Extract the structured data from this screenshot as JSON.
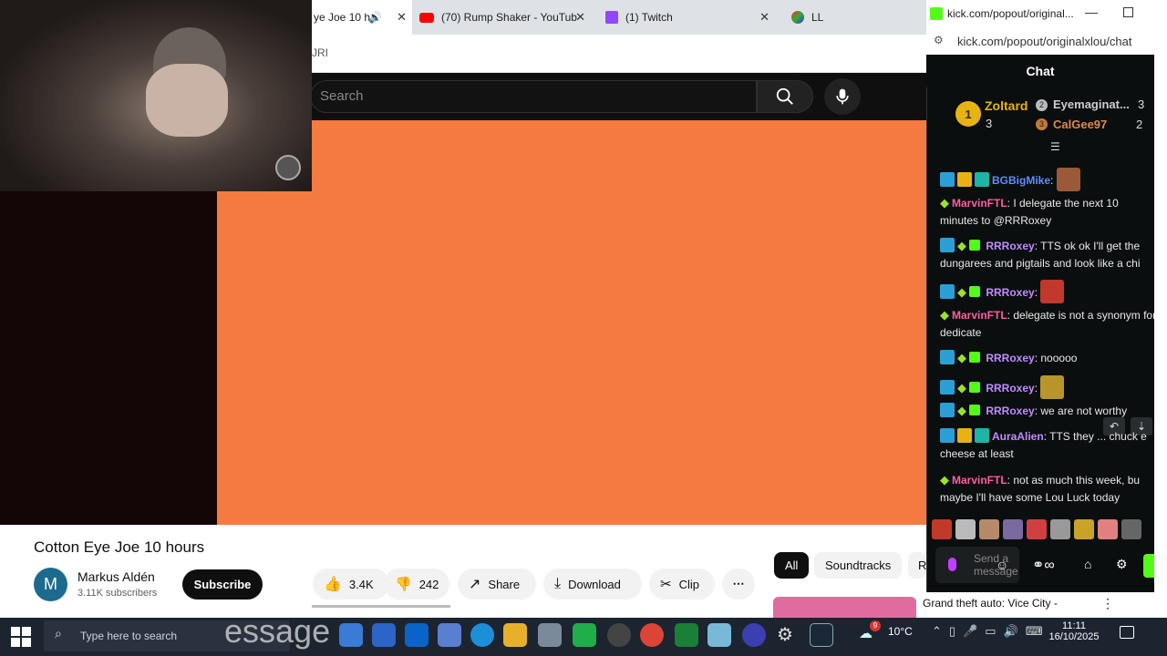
{
  "browser": {
    "tabs": [
      {
        "label": "ye Joe 10 h",
        "icon": "speaker-icon"
      },
      {
        "label": "(70) Rump Shaker - YouTub",
        "icon": "youtube-icon"
      },
      {
        "label": "(1) Twitch",
        "icon": "twitch-icon"
      },
      {
        "label": "LL",
        "icon": "tab-favicon"
      }
    ],
    "address_fragment": "JRI"
  },
  "youtube": {
    "search_placeholder": "Search",
    "video_title": "Cotton Eye Joe 10 hours",
    "channel": {
      "avatar_letter": "M",
      "name": "Markus Aldén",
      "subscribers": "3.11K subscribers"
    },
    "subscribe_label": "Subscribe",
    "likes": "3.4K",
    "dislikes": "242",
    "share_label": "Share",
    "download_label": "Download",
    "clip_label": "Clip",
    "chips": [
      "All",
      "Soundtracks",
      "R"
    ],
    "next_video_title": "Grand theft auto: Vice City -"
  },
  "popout": {
    "window_title": "kick.com/popout/original...",
    "url": "kick.com/popout/originalxlou/chat",
    "chat_header": "Chat",
    "leaderboard": [
      {
        "rank": "1",
        "name": "Zoltard",
        "count": "3"
      },
      {
        "rank": "2",
        "name": "Eyemaginat...",
        "count": "3"
      },
      {
        "rank": "3",
        "name": "CalGee97",
        "count": "2"
      }
    ],
    "messages": [
      {
        "user": "BGBigMike",
        "text": ""
      },
      {
        "user": "MarvinFTL",
        "text": ": I delegate the next 10 minutes to @RRRoxey"
      },
      {
        "user": "RRRoxey",
        "text": ": TTS ok ok I'll get the dungarees and pigtails and look like a chi"
      },
      {
        "user": "RRRoxey",
        "text": ":"
      },
      {
        "user": "MarvinFTL",
        "text": ": delegate is not a synonym for dedicate"
      },
      {
        "user": "RRRoxey",
        "text": ": nooooo"
      },
      {
        "user": "RRRoxey",
        "text": ":"
      },
      {
        "user": "RRRoxey",
        "text": ": we are not worthy"
      },
      {
        "user": "AuraAlien",
        "text": ": TTS they ... chuck e cheese at least"
      },
      {
        "user": "MarvinFTL",
        "text": ": not as much this week, bu maybe I'll have some Lou Luck today"
      }
    ],
    "input_placeholder": "Send a message"
  },
  "taskbar": {
    "search_placeholder": "Type here to search",
    "overlay_text": "essage",
    "weather": "10°C",
    "weather_badge": "9",
    "time": "11:11",
    "date": "16/10/2025"
  },
  "colors": {
    "video": "#f47a40",
    "kick_green": "#53fc18",
    "taskbar": "#1c2430"
  }
}
